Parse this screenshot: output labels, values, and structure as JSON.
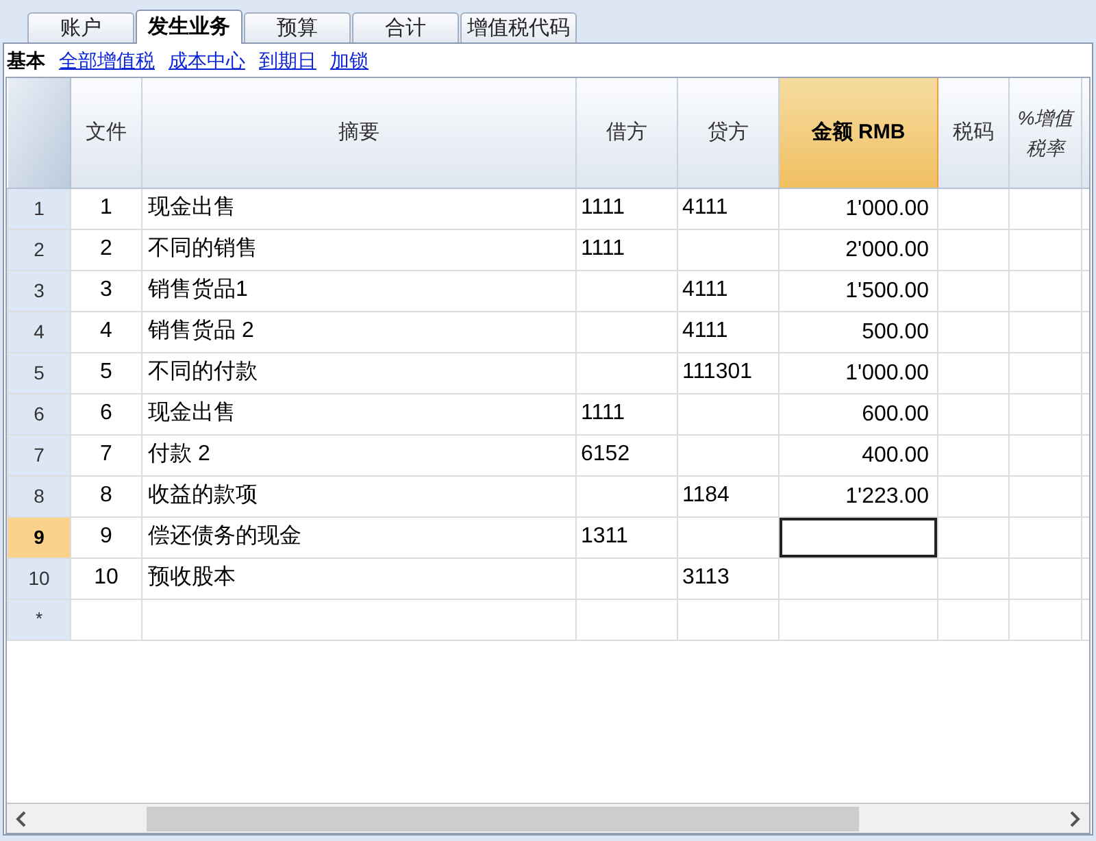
{
  "tabs": [
    {
      "label": "账户",
      "selected": false
    },
    {
      "label": "发生业务",
      "selected": true
    },
    {
      "label": "预算",
      "selected": false
    },
    {
      "label": "合计",
      "selected": false
    },
    {
      "label": "增值税代码",
      "selected": false
    }
  ],
  "views": [
    {
      "label": "基本",
      "selected": true
    },
    {
      "label": "全部增值税",
      "selected": false
    },
    {
      "label": "成本中心",
      "selected": false
    },
    {
      "label": "到期日",
      "selected": false
    },
    {
      "label": "加锁",
      "selected": false
    }
  ],
  "table": {
    "columns": [
      {
        "label": "文件",
        "selected": false,
        "italic": false
      },
      {
        "label": "摘要",
        "selected": false,
        "italic": false
      },
      {
        "label": "借方",
        "selected": false,
        "italic": false
      },
      {
        "label": "贷方",
        "selected": false,
        "italic": false
      },
      {
        "label": "金额 RMB",
        "selected": true,
        "italic": false
      },
      {
        "label": "税码",
        "selected": false,
        "italic": false
      },
      {
        "label": "%增值税率",
        "selected": false,
        "italic": true
      }
    ],
    "rows": [
      {
        "number": "1",
        "selected": false,
        "doc": "1",
        "description": "现金出售",
        "debit": "1111",
        "credit": "4111",
        "amount": "1'000.00",
        "amount_focused": false
      },
      {
        "number": "2",
        "selected": false,
        "doc": "2",
        "description": "不同的销售",
        "debit": "1111",
        "amount": "2'000.00",
        "amount_focused": false
      },
      {
        "number": "3",
        "selected": false,
        "doc": "3",
        "description": "销售货品1",
        "credit": "4111",
        "amount": "1'500.00",
        "amount_focused": false
      },
      {
        "number": "4",
        "selected": false,
        "doc": "4",
        "description": "销售货品 2",
        "credit": "4111",
        "amount": "500.00",
        "amount_focused": false
      },
      {
        "number": "5",
        "selected": false,
        "doc": "5",
        "description": "不同的付款",
        "credit": "111301",
        "amount": "1'000.00",
        "amount_focused": false
      },
      {
        "number": "6",
        "selected": false,
        "doc": "6",
        "description": "现金出售",
        "debit": "1111",
        "amount": "600.00",
        "amount_focused": false
      },
      {
        "number": "7",
        "selected": false,
        "doc": "7",
        "description": "付款 2",
        "debit": "6152",
        "amount": "400.00",
        "amount_focused": false
      },
      {
        "number": "8",
        "selected": false,
        "doc": "8",
        "description": "收益的款项",
        "credit": "1184",
        "amount": "1'223.00",
        "amount_focused": false
      },
      {
        "number": "9",
        "selected": true,
        "doc": "9",
        "description": "偿还债务的现金",
        "debit": "1311",
        "amount_focused": true
      },
      {
        "number": "10",
        "selected": false,
        "doc": "10",
        "description": "预收股本",
        "credit": "3113",
        "amount_focused": false
      }
    ],
    "new_row": {
      "marker": "*"
    }
  }
}
